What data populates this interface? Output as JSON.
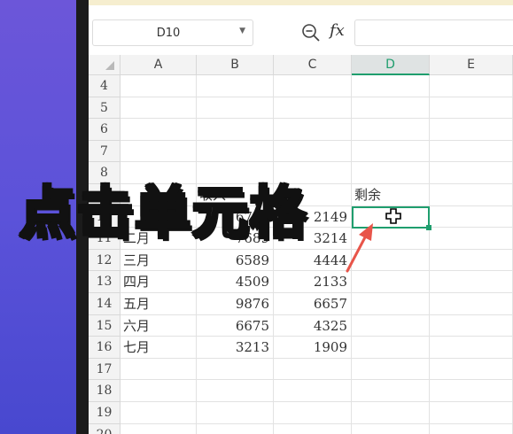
{
  "namebox": {
    "value": "D10"
  },
  "formula": {
    "fx_label": "fx",
    "value": ""
  },
  "columns": [
    "A",
    "B",
    "C",
    "D",
    "E"
  ],
  "active_column": "D",
  "rows": [
    {
      "num": "4",
      "a": "",
      "b": "",
      "c": "",
      "d": ""
    },
    {
      "num": "5",
      "a": "",
      "b": "",
      "c": "",
      "d": ""
    },
    {
      "num": "6",
      "a": "",
      "b": "",
      "c": "",
      "d": ""
    },
    {
      "num": "7",
      "a": "",
      "b": "",
      "c": "",
      "d": ""
    },
    {
      "num": "8",
      "a": "",
      "b": "",
      "c": "",
      "d": ""
    },
    {
      "num": "9",
      "a": "",
      "b": "收入",
      "c": "",
      "d": "剩余"
    },
    {
      "num": "10",
      "a": "",
      "b": "6790",
      "c": "2149",
      "d": ""
    },
    {
      "num": "11",
      "a": "二月",
      "b": "7689",
      "c": "3214",
      "d": ""
    },
    {
      "num": "12",
      "a": "三月",
      "b": "6589",
      "c": "4444",
      "d": ""
    },
    {
      "num": "13",
      "a": "四月",
      "b": "4509",
      "c": "2133",
      "d": ""
    },
    {
      "num": "14",
      "a": "五月",
      "b": "9876",
      "c": "6657",
      "d": ""
    },
    {
      "num": "15",
      "a": "六月",
      "b": "6675",
      "c": "4325",
      "d": ""
    },
    {
      "num": "16",
      "a": "七月",
      "b": "3213",
      "c": "1909",
      "d": ""
    },
    {
      "num": "17",
      "a": "",
      "b": "",
      "c": "",
      "d": ""
    },
    {
      "num": "18",
      "a": "",
      "b": "",
      "c": "",
      "d": ""
    },
    {
      "num": "19",
      "a": "",
      "b": "",
      "c": "",
      "d": ""
    },
    {
      "num": "20",
      "a": "",
      "b": "",
      "c": "",
      "d": ""
    }
  ],
  "overlay_caption": "点击单元格",
  "colors": {
    "accent": "#1f9e6e",
    "arrow": "#e8554a"
  }
}
